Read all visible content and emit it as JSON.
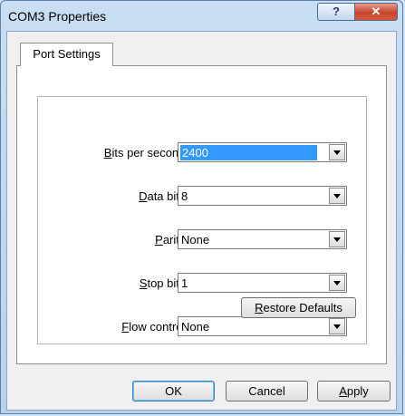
{
  "window": {
    "title": "COM3 Properties",
    "help_label": "?",
    "close_label": "✕"
  },
  "tabs": [
    {
      "label": "Port Settings",
      "active": true
    }
  ],
  "fields": {
    "bits_per_second": {
      "label_pre": "",
      "label_mn": "B",
      "label_post": "its per second:",
      "value": "2400"
    },
    "data_bits": {
      "label_pre": "",
      "label_mn": "D",
      "label_post": "ata bits:",
      "value": "8"
    },
    "parity": {
      "label_pre": "",
      "label_mn": "P",
      "label_post": "arity:",
      "value": "None"
    },
    "stop_bits": {
      "label_pre": "",
      "label_mn": "S",
      "label_post": "top bits:",
      "value": "1"
    },
    "flow_control": {
      "label_pre": "",
      "label_mn": "F",
      "label_post": "low control:",
      "value": "None"
    }
  },
  "buttons": {
    "restore": {
      "mn": "R",
      "rest": "estore Defaults"
    },
    "ok": "OK",
    "cancel": "Cancel",
    "apply": {
      "mn": "A",
      "rest": "pply"
    }
  },
  "icons": [
    "help-icon",
    "close-icon",
    "chevron-down-icon"
  ]
}
